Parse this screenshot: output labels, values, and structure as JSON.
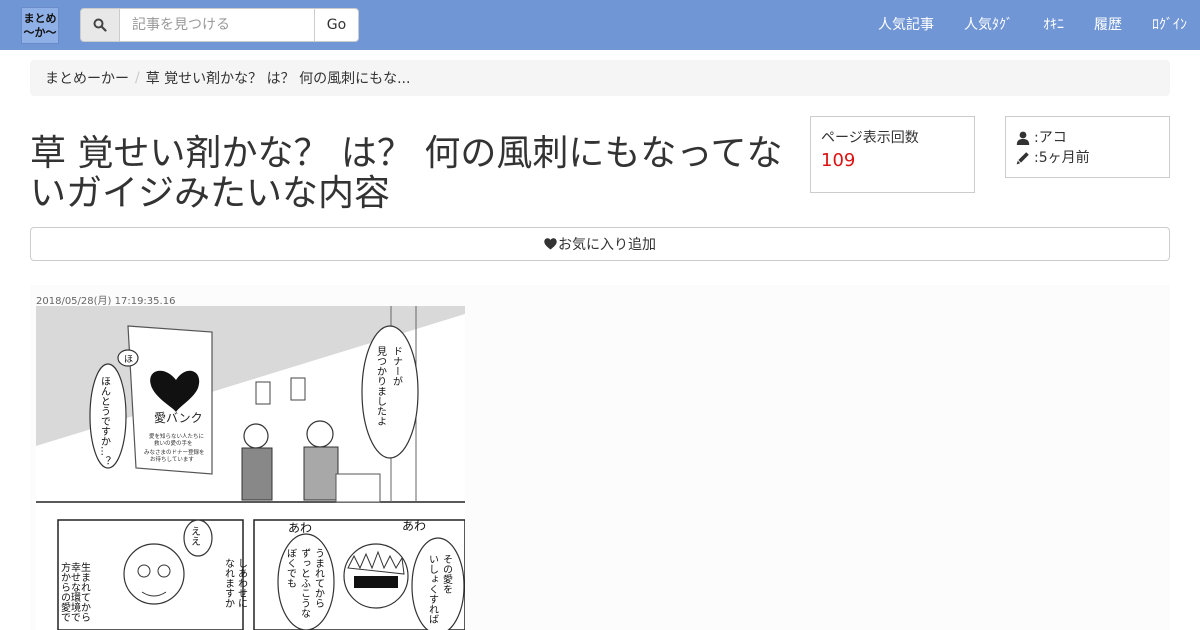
{
  "navbar": {
    "logo_text": "まとめ\n〜か〜",
    "search_placeholder": "記事を見つける",
    "search_value": "",
    "go_label": "Go",
    "links": [
      "人気記事",
      "人気ﾀｸﾞ",
      "ｵｷﾆ",
      "履歴",
      "ﾛｸﾞｲﾝ"
    ]
  },
  "breadcrumb": {
    "home": "まとめーかー",
    "current": "草 覚せい剤かな？ は？ 何の風刺にもな..."
  },
  "article": {
    "title": "草 覚せい剤かな？ は？ 何の風刺にもなってないガイジみたいな内容",
    "views_label": "ページ表示回数",
    "views_count": "109",
    "author": ":アコ",
    "posted": ":5ヶ月前",
    "favorite_label": "お気に入り追加"
  },
  "post": {
    "date": "2018/05/28(月) 17:19:35.16",
    "manga": {
      "poster_title": "愛バンク",
      "poster_text_1": "愛を知らない人たちに",
      "poster_text_2": "救いの愛の手を",
      "poster_text_3": "みなさまのドナー登録を",
      "poster_text_4": "お待ちしています",
      "bubble_ho": "ほ",
      "bubble_left_1": "ほんとうですか…？",
      "bubble_right_1": "ドナーが",
      "bubble_right_2": "見つかりましたよ",
      "bubble_ee": "ええ",
      "bubble_p2_1": "生まれてから",
      "bubble_p2_2": "幸せな環境で",
      "bubble_p2_3": "方からの愛で",
      "bubble_p2_4": "しあわせに",
      "bubble_p2_5": "なれますか",
      "bubble_p2_6": "うまれてから",
      "bubble_p2_7": "ずっとふこうな",
      "bubble_p2_8": "ぼくでも",
      "bubble_p2_9": "その愛を",
      "bubble_p2_10": "いしょくすれば",
      "sfx_awa": "あわ",
      "sfx_awa2": "あわ"
    }
  },
  "colors": {
    "navbar": "#7196d6",
    "views_count": "#dd1111"
  }
}
